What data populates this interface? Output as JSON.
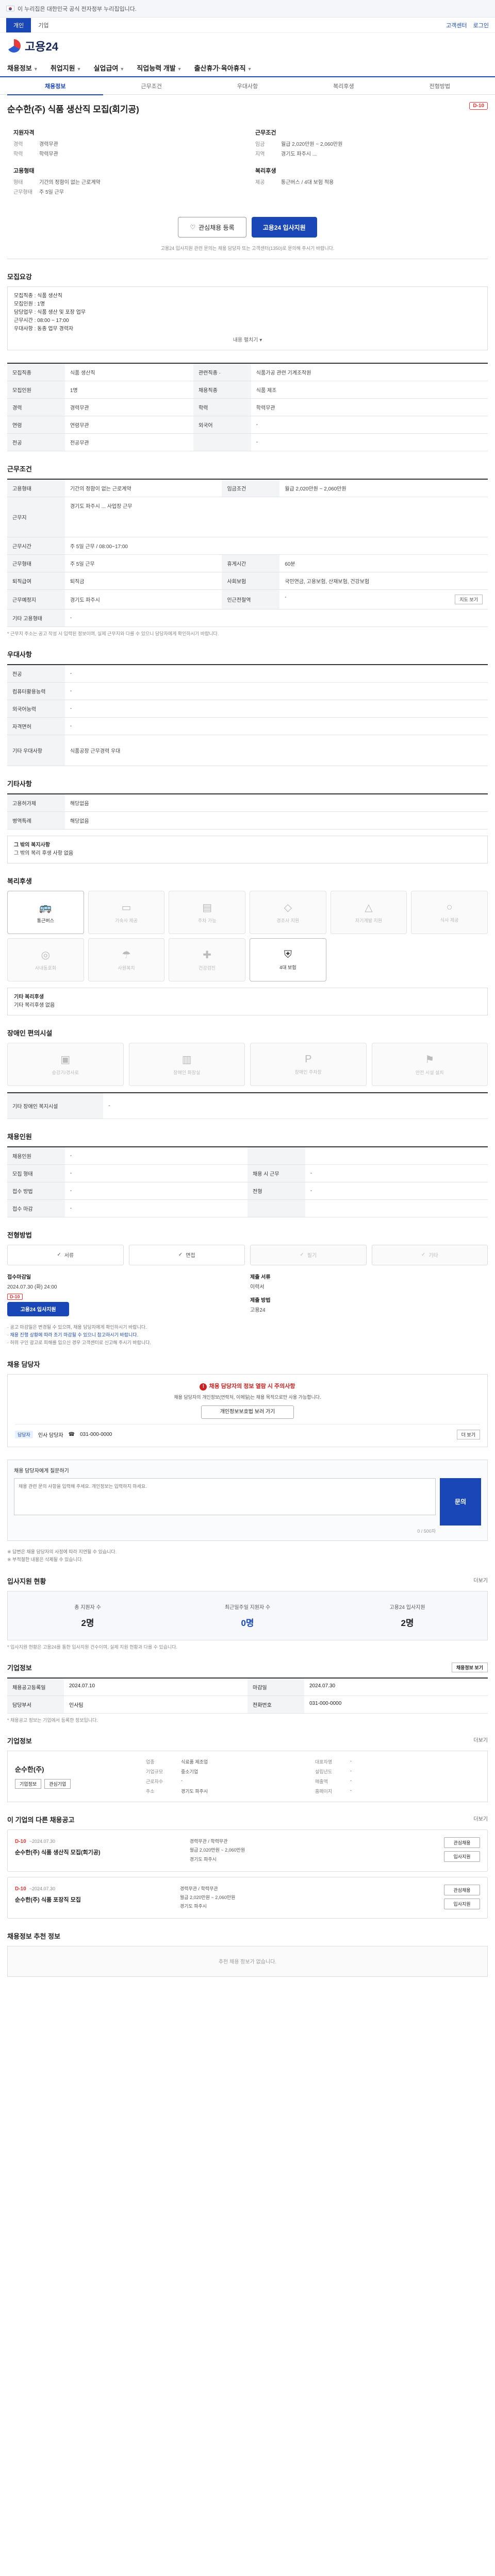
{
  "gov_banner": "이 누리집은 대한민국 공식 전자정부 누리집입니다.",
  "subbar": {
    "tabs": [
      "개인",
      "기업"
    ],
    "links": [
      "고객센터",
      "로그인"
    ]
  },
  "logo": "고용24",
  "gnb": [
    "채용정보",
    "취업지원",
    "실업급여",
    "직업능력 개발",
    "출산휴가·육아휴직"
  ],
  "lnb": [
    "채용정보",
    "근무조건",
    "우대사항",
    "복리후생",
    "전형방법"
  ],
  "job": {
    "title": "순수한(주) 식품 생산직 모집(회기공)",
    "dday": "D-10",
    "summary": [
      {
        "head": "지원자격",
        "rows": [
          [
            "경력",
            "경력무관"
          ],
          [
            "학력",
            "학력무관"
          ]
        ]
      },
      {
        "head": "근무조건",
        "rows": [
          [
            "임금",
            "월급 2,020만원 ~ 2,060만원"
          ],
          [
            "지역",
            "경기도 파주시 ..."
          ]
        ]
      },
      {
        "head": "고용형태",
        "rows": [
          [
            "형태",
            "기간의 정함이 없는 근로계약"
          ],
          [
            "근무형태",
            "주 5일 근무"
          ]
        ]
      },
      {
        "head": "복리후생",
        "rows": [
          [
            "제공",
            "통근버스 / 4대 보험 적용"
          ]
        ]
      }
    ],
    "btn_scrap": "관심채용 등록",
    "btn_apply": "고용24 입사지원",
    "notice": "고용24 입사지원 관련 문의는 채용 담당자 또는 고객센터(1350)로 문의해 주시기 바랍니다."
  },
  "recruit": {
    "title": "모집요강",
    "body": [
      "모집직종 : 식품 생산직",
      "모집인원 : 1명",
      "담당업무 : 식품 생산 및 포장 업무",
      "근무시간 : 08:00 ~ 17:00",
      "우대사항 : 동종 업무 경력자"
    ],
    "fold": "내용 펼치기"
  },
  "req_table": {
    "rows": [
      [
        "모집직종",
        "식품 생산직",
        "관련직종 ·",
        "식품가공 관련 기계조작원"
      ],
      [
        "모집인원",
        "1명",
        "채용직종",
        "식품 제조"
      ],
      [
        "경력",
        "경력무관",
        "학력",
        "학력무관"
      ],
      [
        "연령",
        "연령무관",
        "외국어",
        "-"
      ],
      [
        "전공",
        "전공무관",
        "",
        "-"
      ]
    ]
  },
  "cond": {
    "title": "근무조건",
    "rows": [
      [
        "고용형태",
        "기간의 정함이 없는 근로계약",
        "임금조건",
        "월급 2,020만원 ~ 2,060만원"
      ],
      [
        "근무지",
        "경기도 파주시 ... 사업장 근무",
        "",
        " "
      ],
      [
        "근무시간",
        "주 5일 근무 / 08:00~17:00",
        "",
        ""
      ],
      [
        "근무형태",
        "주 5일 근무",
        "휴게시간",
        "60분"
      ],
      [
        "퇴직급여",
        "퇴직금",
        "사회보험",
        "국민연금, 고용보험, 산재보험, 건강보험"
      ],
      [
        "근무예정지",
        "경기도 파주시",
        "인근전철역",
        "-"
      ],
      [
        "기타 고용형태",
        "-",
        "",
        ""
      ]
    ],
    "note": "* 근무지 주소는 공고 작성 시 입력된 정보이며, 실제 근무지와 다를 수 있으니 담당자에게 확인하시기 바랍니다.",
    "map_btn": "지도 보기"
  },
  "pref": {
    "title": "우대사항",
    "rows": [
      [
        "전공",
        "-"
      ],
      [
        "컴퓨터활용능력",
        "-"
      ],
      [
        "외국어능력",
        "-"
      ],
      [
        "자격면허",
        "-"
      ],
      [
        "기타 우대사항",
        "식품공장 근무경력 우대"
      ]
    ]
  },
  "etc": {
    "title": "기타사항",
    "rows": [
      [
        "고용허가제",
        "해당없음"
      ],
      [
        "병역특례",
        "해당없음"
      ]
    ],
    "sub_title": "그 밖의 복지사항",
    "sub_body": "그 밖의 복리 후생 사항 없음"
  },
  "welfare": {
    "title": "복리후생",
    "items": [
      {
        "icon": "truck-icon",
        "label": "통근버스",
        "on": true
      },
      {
        "icon": "meal-icon",
        "label": "기숙사 제공",
        "on": false
      },
      {
        "icon": "car-icon",
        "label": "주차 가능",
        "on": false
      },
      {
        "icon": "gift-icon",
        "label": "경조사 지원",
        "on": false
      },
      {
        "icon": "cap-icon",
        "label": "자기계발 지원",
        "on": false
      },
      {
        "icon": "coffee-icon",
        "label": "식사 제공",
        "on": false
      },
      {
        "icon": "pin-icon",
        "label": "사내동호회",
        "on": false
      },
      {
        "icon": "umbrella-icon",
        "label": "사원복지",
        "on": false
      },
      {
        "icon": "health-icon",
        "label": "건강검진",
        "on": false
      },
      {
        "icon": "shield-icon",
        "label": "4대 보험",
        "on": true
      }
    ],
    "note_title": "기타 복리후생",
    "note_body": "기타 복리후생 없음"
  },
  "disability": {
    "title": "장애인 편의시설",
    "items": [
      "승강기/경사로",
      "장애인 화장실",
      "장애인 주차장",
      "안전 시설 설치"
    ],
    "rows": [
      [
        "기타 장애인 복지시설",
        "-"
      ]
    ]
  },
  "worker": {
    "title": "채용인원",
    "rows": [
      [
        "채용인원",
        "-",
        "",
        ""
      ],
      [
        "모집 형태",
        "-",
        "채용 시 근무",
        "-"
      ],
      [
        "접수 방법",
        "-",
        "전형",
        "-"
      ],
      [
        "접수 마감",
        "-",
        "",
        ""
      ]
    ]
  },
  "process": {
    "title": "전형방법",
    "steps": [
      {
        "label": "서류",
        "on": true
      },
      {
        "label": "면접",
        "on": true
      },
      {
        "label": "필기",
        "on": false
      },
      {
        "label": "기타",
        "on": false
      }
    ],
    "apply_label": "접수마감일",
    "apply_val": "2024.07.30 (화) 24:00",
    "apply_tag": "D-10",
    "apply_btn": "고용24 입사지원",
    "doc_label": "제출 서류",
    "doc_val": "이력서",
    "doc_label2": "제출 방법",
    "doc_val2": "고용24"
  },
  "notes": [
    "공고 마감일은 변경될 수 있으며, 채용 담당자에게 확인하시기 바랍니다.",
    "채용 진행 상황에 따라 조기 마감될 수 있으니 참고하시기 바랍니다.",
    "허위 구인 광고로 피해를 입으신 경우 고객센터로 신고해 주시기 바랍니다."
  ],
  "manager": {
    "title": "채용 담당자",
    "warn": "채용 담당자의 정보 열람 시 주의사항",
    "desc": "채용 담당자의 개인정보(연락처, 이메일)는 채용 목적으로만 사용 가능합니다.",
    "btn": "개인정보보호법 보러 가기",
    "tag": "담당자",
    "name": "인사 담당자",
    "phone": "031-000-0000",
    "more": "더 보기"
  },
  "question": {
    "title": "채용 담당자에게 질문하기",
    "hint": "질문 내용을 입력하세요.",
    "placeholder": "채용 관련 문의 사항을 입력해 주세요. 개인정보는 입력하지 마세요.",
    "count": "0 / 500자",
    "send": "문의",
    "foot1": "※ 답변은 채용 담당자의 사정에 따라 지연될 수 있습니다.",
    "foot2": "※ 부적절한 내용은 삭제될 수 있습니다."
  },
  "stats": {
    "title": "입사지원 현황",
    "more": "더보기",
    "items": [
      {
        "label": "총 지원자 수",
        "val": "2명",
        "blue": false
      },
      {
        "label": "최근일주일 지원자 수",
        "val": "0명",
        "blue": true
      },
      {
        "label": "고용24 입사지원",
        "val": "2명",
        "blue": false
      }
    ],
    "note": "* 입사지원 현황은 고용24를 통한 입사지원 건수이며, 실제 지원 현황과 다를 수 있습니다."
  },
  "info": {
    "title": "기업정보",
    "btn": "채용정보 보기",
    "rows": [
      [
        "채용공고등록일",
        "2024.07.10",
        "마감일",
        "2024.07.30"
      ],
      [
        "담당부서",
        "인사팀",
        "전화번호",
        "031-000-0000"
      ]
    ],
    "note": "* 채용공고 정보는 기업에서 등록한 정보입니다."
  },
  "company": {
    "title": "기업정보",
    "more": "더보기",
    "name": "순수한(주)",
    "btns": [
      "기업정보",
      "관심기업"
    ],
    "rows": [
      [
        "업종",
        "식료품 제조업",
        "대표자명",
        "-"
      ],
      [
        "기업규모",
        "중소기업",
        "설립년도",
        "-"
      ],
      [
        "근로자수",
        "-",
        "매출액",
        "-"
      ],
      [
        "주소",
        "경기도 파주시",
        "홈페이지",
        "-"
      ]
    ]
  },
  "others": {
    "title": "이 기업의 다른 채용공고",
    "more": "더보기",
    "items": [
      {
        "dday": "D-10",
        "date": "~2024.07.30",
        "title": "순수한(주) 식품 생산직 모집(회기공)",
        "m": [
          "경력무관 / 학력무관",
          "월급 2,020만원 ~ 2,060만원",
          "경기도 파주시"
        ],
        "btns": [
          "관심채용",
          "입사지원"
        ]
      },
      {
        "dday": "D-10",
        "date": "~2024.07.30",
        "title": "순수한(주) 식품 포장직 모집",
        "m": [
          "경력무관 / 학력무관",
          "월급 2,020만원 ~ 2,060만원",
          "경기도 파주시"
        ],
        "btns": [
          "관심채용",
          "입사지원"
        ]
      }
    ]
  },
  "recent": {
    "title": "채용정보 추천 정보",
    "empty": "추천 채용 정보가 없습니다."
  },
  "icons": {
    "search": "search-icon"
  }
}
